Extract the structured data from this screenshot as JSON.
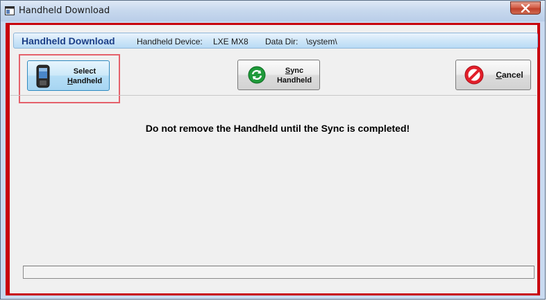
{
  "window": {
    "title": "Handheld Download",
    "close_label": "x"
  },
  "header": {
    "title": "Handheld Download",
    "device_label": "Handheld Device:",
    "device_value": "LXE MX8",
    "dir_label": "Data Dir:",
    "dir_value": "\\system\\"
  },
  "toolbar": {
    "select_line1": "Select",
    "select_line2_key": "H",
    "select_line2_rest": "andheld",
    "sync_line1_key": "S",
    "sync_line1_rest": "ync",
    "sync_line2": "Handheld",
    "cancel_key": "C",
    "cancel_rest": "ancel"
  },
  "message": "Do not remove the Handheld until the Sync is completed!",
  "status": "",
  "colors": {
    "frame_border": "#c8000c",
    "header_title": "#1c3f88",
    "highlight": "#e5616b"
  },
  "icons": {
    "select": "handheld-device-icon",
    "sync": "sync-arrows-icon",
    "cancel": "cancel-prohibited-icon",
    "app": "app-window-icon",
    "close": "close-icon"
  }
}
